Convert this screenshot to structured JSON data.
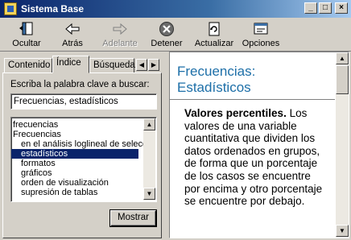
{
  "window": {
    "title": "Sistema Base"
  },
  "toolbar": {
    "ocultar": "Ocultar",
    "atras": "Atrás",
    "adelante": "Adelante",
    "detener": "Detener",
    "actualizar": "Actualizar",
    "opciones": "Opciones"
  },
  "tabs": {
    "contenido": "Contenido",
    "indice": "Índice",
    "busqueda": "Búsqueda"
  },
  "search": {
    "label": "Escriba la palabra clave a buscar:",
    "value": "Frecuencias, estadísticos"
  },
  "index_list": [
    "frecuencias",
    "Frecuencias",
    "en el análisis loglineal de selecc",
    "estadísticos",
    "formatos",
    "gráficos",
    "orden de visualización",
    "supresión de tablas"
  ],
  "buttons": {
    "mostrar": "Mostrar"
  },
  "topic": {
    "title": "Frecuencias: Estadísticos",
    "heading": "Valores percentiles.",
    "body": "Los valores de una variable cuantitativa que dividen los datos ordenados en grupos, de forma que un porcentaje de los casos se encuentre por encima y otro porcentaje se encuentre por debajo."
  },
  "colors": {
    "titlebar": "#0a246a",
    "selection": "#0a246a",
    "topic_title": "#1d6fa8"
  }
}
